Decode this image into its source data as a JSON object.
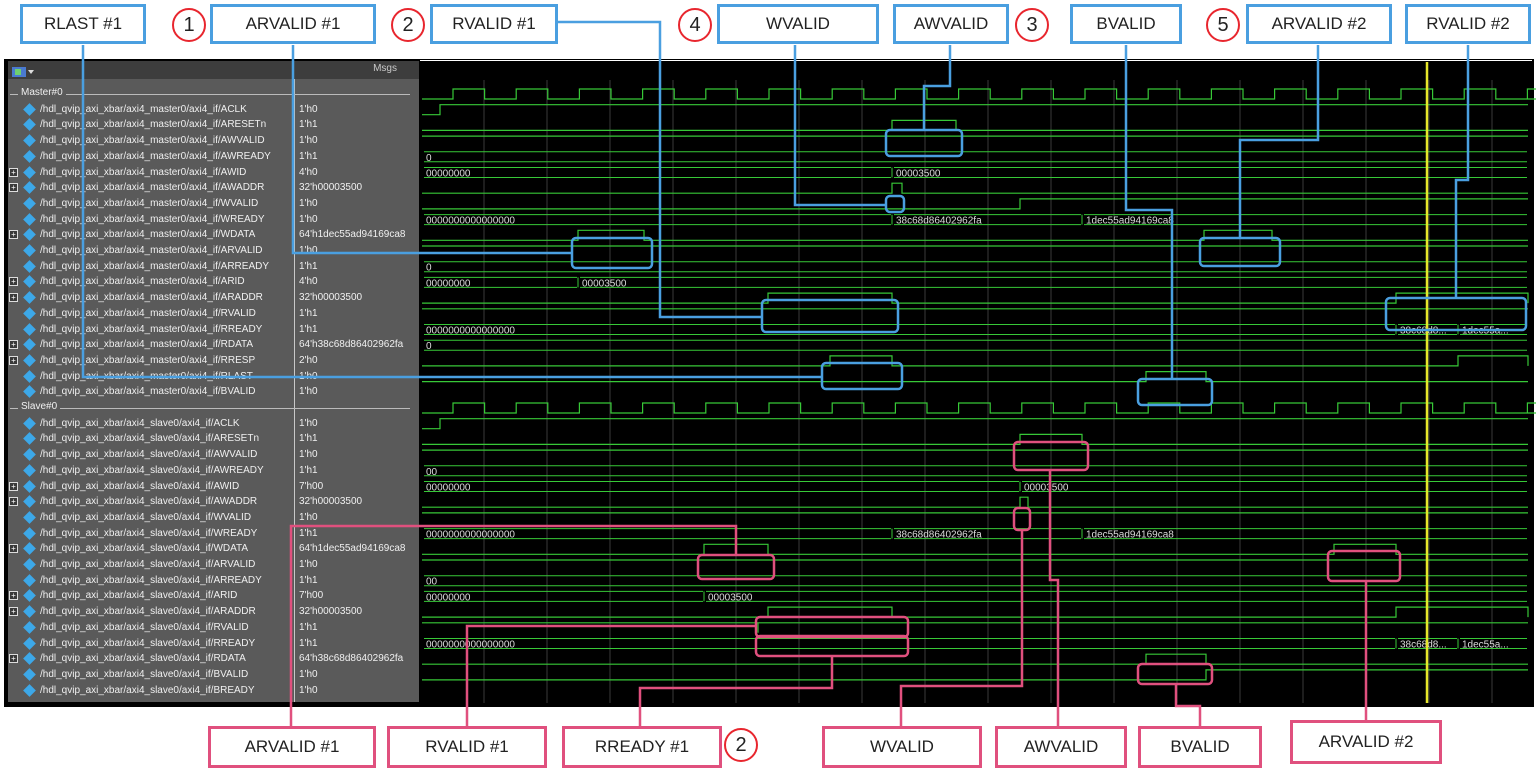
{
  "top_callouts": [
    {
      "id": "rlast1",
      "label": "RLAST #1"
    },
    {
      "id": "arvalid1",
      "label": "ARVALID #1",
      "num": "1"
    },
    {
      "id": "rvalid1",
      "label": "RVALID #1",
      "num": "2"
    },
    {
      "id": "wvalid",
      "label": "WVALID",
      "num": "4"
    },
    {
      "id": "awvalid",
      "label": "AWVALID",
      "num": "3"
    },
    {
      "id": "bvalid",
      "label": "BVALID"
    },
    {
      "id": "arvalid2",
      "label": "ARVALID #2",
      "num": "5"
    },
    {
      "id": "rvalid2",
      "label": "RVALID #2"
    }
  ],
  "bottom_callouts": [
    {
      "id": "s_arvalid1",
      "label": "ARVALID #1"
    },
    {
      "id": "s_rvalid1",
      "label": "RVALID #1"
    },
    {
      "id": "s_rready1",
      "label": "RREADY #1",
      "num": "2"
    },
    {
      "id": "s_wvalid",
      "label": "WVALID"
    },
    {
      "id": "s_awvalid",
      "label": "AWVALID"
    },
    {
      "id": "s_bvalid",
      "label": "BVALID"
    },
    {
      "id": "s_arvalid2",
      "label": "ARVALID #2"
    }
  ],
  "waveform": {
    "header_label": "Msgs",
    "groups": [
      {
        "name": "Master#0",
        "signals": [
          {
            "name": "/hdl_qvip_axi_xbar/axi4_master0/axi4_if/ACLK",
            "value": "1'h0",
            "expandable": false
          },
          {
            "name": "/hdl_qvip_axi_xbar/axi4_master0/axi4_if/ARESETn",
            "value": "1'h1",
            "expandable": false
          },
          {
            "name": "/hdl_qvip_axi_xbar/axi4_master0/axi4_if/AWVALID",
            "value": "1'h0",
            "expandable": false
          },
          {
            "name": "/hdl_qvip_axi_xbar/axi4_master0/axi4_if/AWREADY",
            "value": "1'h1",
            "expandable": false
          },
          {
            "name": "/hdl_qvip_axi_xbar/axi4_master0/axi4_if/AWID",
            "value": "4'h0",
            "expandable": true
          },
          {
            "name": "/hdl_qvip_axi_xbar/axi4_master0/axi4_if/AWADDR",
            "value": "32'h00003500",
            "expandable": true
          },
          {
            "name": "/hdl_qvip_axi_xbar/axi4_master0/axi4_if/WVALID",
            "value": "1'h0",
            "expandable": false
          },
          {
            "name": "/hdl_qvip_axi_xbar/axi4_master0/axi4_if/WREADY",
            "value": "1'h0",
            "expandable": false
          },
          {
            "name": "/hdl_qvip_axi_xbar/axi4_master0/axi4_if/WDATA",
            "value": "64'h1dec55ad94169ca8",
            "expandable": true
          },
          {
            "name": "/hdl_qvip_axi_xbar/axi4_master0/axi4_if/ARVALID",
            "value": "1'h0",
            "expandable": false
          },
          {
            "name": "/hdl_qvip_axi_xbar/axi4_master0/axi4_if/ARREADY",
            "value": "1'h1",
            "expandable": false
          },
          {
            "name": "/hdl_qvip_axi_xbar/axi4_master0/axi4_if/ARID",
            "value": "4'h0",
            "expandable": true
          },
          {
            "name": "/hdl_qvip_axi_xbar/axi4_master0/axi4_if/ARADDR",
            "value": "32'h00003500",
            "expandable": true
          },
          {
            "name": "/hdl_qvip_axi_xbar/axi4_master0/axi4_if/RVALID",
            "value": "1'h1",
            "expandable": false
          },
          {
            "name": "/hdl_qvip_axi_xbar/axi4_master0/axi4_if/RREADY",
            "value": "1'h1",
            "expandable": false
          },
          {
            "name": "/hdl_qvip_axi_xbar/axi4_master0/axi4_if/RDATA",
            "value": "64'h38c68d86402962fa",
            "expandable": true
          },
          {
            "name": "/hdl_qvip_axi_xbar/axi4_master0/axi4_if/RRESP",
            "value": "2'h0",
            "expandable": true
          },
          {
            "name": "/hdl_qvip_axi_xbar/axi4_master0/axi4_if/RLAST",
            "value": "1'h0",
            "expandable": false
          },
          {
            "name": "/hdl_qvip_axi_xbar/axi4_master0/axi4_if/BVALID",
            "value": "1'h0",
            "expandable": false
          }
        ]
      },
      {
        "name": "Slave#0",
        "signals": [
          {
            "name": "/hdl_qvip_axi_xbar/axi4_slave0/axi4_if/ACLK",
            "value": "1'h0",
            "expandable": false
          },
          {
            "name": "/hdl_qvip_axi_xbar/axi4_slave0/axi4_if/ARESETn",
            "value": "1'h1",
            "expandable": false
          },
          {
            "name": "/hdl_qvip_axi_xbar/axi4_slave0/axi4_if/AWVALID",
            "value": "1'h0",
            "expandable": false
          },
          {
            "name": "/hdl_qvip_axi_xbar/axi4_slave0/axi4_if/AWREADY",
            "value": "1'h1",
            "expandable": false
          },
          {
            "name": "/hdl_qvip_axi_xbar/axi4_slave0/axi4_if/AWID",
            "value": "7'h00",
            "expandable": true
          },
          {
            "name": "/hdl_qvip_axi_xbar/axi4_slave0/axi4_if/AWADDR",
            "value": "32'h00003500",
            "expandable": true
          },
          {
            "name": "/hdl_qvip_axi_xbar/axi4_slave0/axi4_if/WVALID",
            "value": "1'h0",
            "expandable": false
          },
          {
            "name": "/hdl_qvip_axi_xbar/axi4_slave0/axi4_if/WREADY",
            "value": "1'h1",
            "expandable": false
          },
          {
            "name": "/hdl_qvip_axi_xbar/axi4_slave0/axi4_if/WDATA",
            "value": "64'h1dec55ad94169ca8",
            "expandable": true
          },
          {
            "name": "/hdl_qvip_axi_xbar/axi4_slave0/axi4_if/ARVALID",
            "value": "1'h0",
            "expandable": false
          },
          {
            "name": "/hdl_qvip_axi_xbar/axi4_slave0/axi4_if/ARREADY",
            "value": "1'h1",
            "expandable": false
          },
          {
            "name": "/hdl_qvip_axi_xbar/axi4_slave0/axi4_if/ARID",
            "value": "7'h00",
            "expandable": true
          },
          {
            "name": "/hdl_qvip_axi_xbar/axi4_slave0/axi4_if/ARADDR",
            "value": "32'h00003500",
            "expandable": true
          },
          {
            "name": "/hdl_qvip_axi_xbar/axi4_slave0/axi4_if/RVALID",
            "value": "1'h1",
            "expandable": false
          },
          {
            "name": "/hdl_qvip_axi_xbar/axi4_slave0/axi4_if/RREADY",
            "value": "1'h1",
            "expandable": false
          },
          {
            "name": "/hdl_qvip_axi_xbar/axi4_slave0/axi4_if/RDATA",
            "value": "64'h38c68d86402962fa",
            "expandable": true
          },
          {
            "name": "/hdl_qvip_axi_xbar/axi4_slave0/axi4_if/BVALID",
            "value": "1'h0",
            "expandable": false
          },
          {
            "name": "/hdl_qvip_axi_xbar/axi4_slave0/axi4_if/BREADY",
            "value": "1'h0",
            "expandable": false
          }
        ]
      }
    ],
    "bus_labels": {
      "m_awid_zero": "0",
      "m_awaddr_init": "00000000",
      "m_awaddr_new": "00003500",
      "m_wdata_init": "0000000000000000",
      "m_wdata_1": "38c68d86402962fa",
      "m_wdata_2": "1dec55ad94169ca8",
      "m_arid_zero": "0",
      "m_araddr_init": "00000000",
      "m_araddr_new": "00003500",
      "m_rdata_init": "0000000000000000",
      "m_rdata_1": "38c68d8...",
      "m_rdata_2": "1dec55a...",
      "m_rresp_zero": "0",
      "s_awid_zero": "00",
      "s_awaddr_init": "00000000",
      "s_awaddr_new": "00003500",
      "s_wdata_init": "0000000000000000",
      "s_wdata_1": "38c68d86402962fa",
      "s_wdata_2": "1dec55ad94169ca8",
      "s_arid_zero": "00",
      "s_araddr_init": "00000000",
      "s_araddr_new": "00003500",
      "s_rdata_init": "0000000000000000",
      "s_rdata_1": "38c68d8...",
      "s_rdata_2": "1dec55a..."
    }
  },
  "colors": {
    "signal": "#37c837",
    "cursor": "#e6e62a",
    "master_callout": "#4a9fe0",
    "slave_callout": "#e0507e",
    "number_circle": "#e8262e"
  }
}
